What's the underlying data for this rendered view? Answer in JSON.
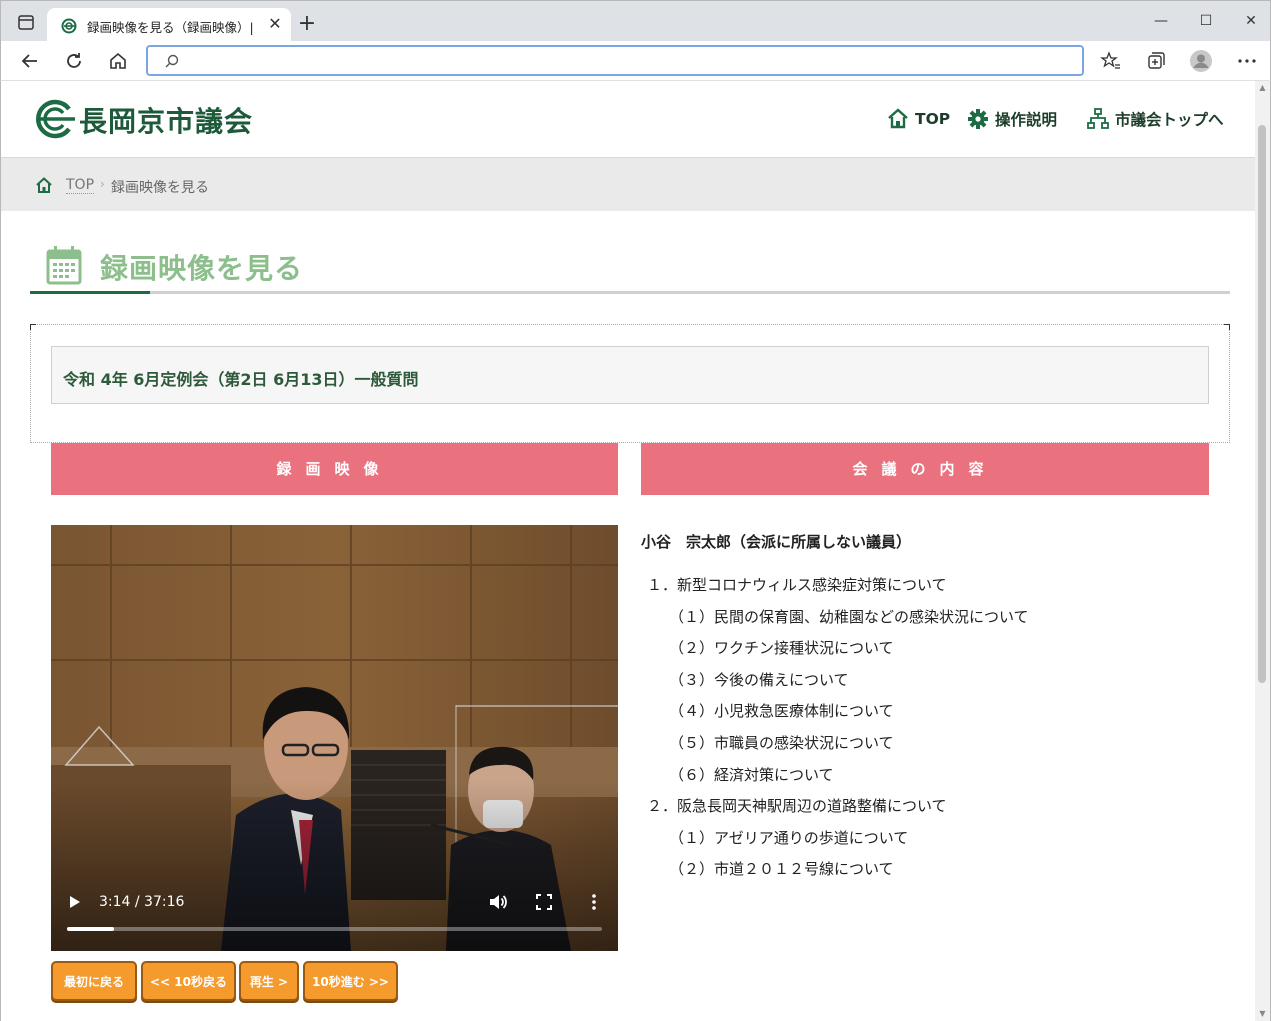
{
  "browser": {
    "tab_title": "録画映像を見る（録画映像）| 長",
    "tab_close": "✕",
    "new_tab": "+",
    "address_value": "",
    "window_min": "—",
    "window_max": "☐",
    "window_close": "✕"
  },
  "header": {
    "logo_text": "長岡京市議会",
    "nav": [
      {
        "label": "TOP",
        "icon": "home-icon"
      },
      {
        "label": "操作説明",
        "icon": "gear-icon"
      },
      {
        "label": "市議会トップへ",
        "icon": "sitemap-icon"
      }
    ]
  },
  "breadcrumb": {
    "top": "TOP",
    "separator": "›",
    "current": "録画映像を見る"
  },
  "page_title": "録画映像を見る",
  "meeting_title": "令和 4年 6月定例会（第2日 6月13日）一般質問",
  "sections": {
    "video": "録画映像",
    "content": "会議の内容"
  },
  "video": {
    "time": "3:14 / 37:16",
    "progress": 0.087
  },
  "buttons": {
    "rewind_start": "最初に戻る",
    "back10": "<< 10秒戻る",
    "play": "再生 >",
    "fwd10": "10秒進む >>"
  },
  "content": {
    "member": "小谷　宗太郎（会派に所属しない議員）",
    "topics": [
      {
        "label": "１．新型コロナウィルス感染症対策について",
        "subs": [
          "（１）民間の保育園、幼稚園などの感染状況について",
          "（２）ワクチン接種状況について",
          "（３）今後の備えについて",
          "（４）小児救急医療体制について",
          "（５）市職員の感染状況について",
          "（６）経済対策について"
        ]
      },
      {
        "label": "２．阪急長岡天神駅周辺の道路整備について",
        "subs": [
          "（１）アゼリア通りの歩道について",
          "（２）市道２０１２号線について"
        ]
      }
    ]
  },
  "colors": {
    "brand_green": "#1d5a3a",
    "title_green": "#8dbf8d",
    "section_pink": "#e9727e",
    "button_orange": "#f59a2c"
  }
}
